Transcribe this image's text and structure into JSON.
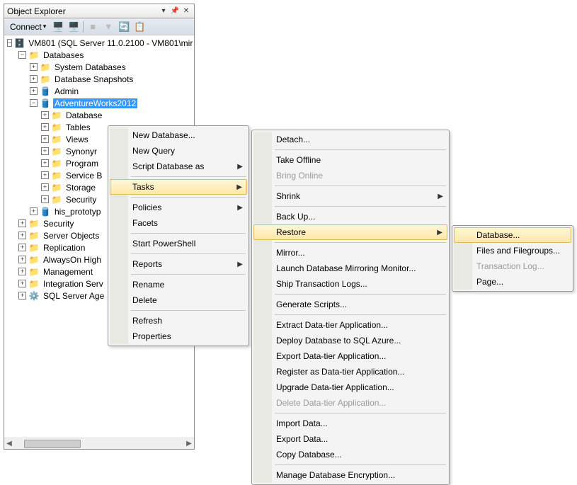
{
  "panel": {
    "title": "Object Explorer"
  },
  "toolbar": {
    "connect": "Connect"
  },
  "tree": {
    "server": "VM801 (SQL Server 11.0.2100 - VM801\\mir",
    "databases": "Databases",
    "sysdb": "System Databases",
    "snapshots": "Database Snapshots",
    "admin": "Admin",
    "aw": "AdventureWorks2012",
    "dbd": "Database",
    "tables": "Tables",
    "views": "Views",
    "synonyms": "Synonyr",
    "programmability": "Program",
    "servicebroker": "Service B",
    "storage": "Storage",
    "security_inner": "Security",
    "his": "his_prototyp",
    "security": "Security",
    "serverobjects": "Server Objects",
    "replication": "Replication",
    "alwayson": "AlwaysOn High",
    "management": "Management",
    "integration": "Integration Serv",
    "sqlagent": "SQL Server Age"
  },
  "menu1": {
    "newdb": "New Database...",
    "newquery": "New Query",
    "scriptdb": "Script Database as",
    "tasks": "Tasks",
    "policies": "Policies",
    "facets": "Facets",
    "startps": "Start PowerShell",
    "reports": "Reports",
    "rename": "Rename",
    "delete": "Delete",
    "refresh": "Refresh",
    "properties": "Properties"
  },
  "menu2": {
    "detach": "Detach...",
    "takeoffline": "Take Offline",
    "bringonline": "Bring Online",
    "shrink": "Shrink",
    "backup": "Back Up...",
    "restore": "Restore",
    "mirror": "Mirror...",
    "launchmirror": "Launch Database Mirroring Monitor...",
    "shiplogs": "Ship Transaction Logs...",
    "genscripts": "Generate Scripts...",
    "extractdac": "Extract Data-tier Application...",
    "deployazure": "Deploy Database to SQL Azure...",
    "exportdac": "Export Data-tier Application...",
    "registerdac": "Register as Data-tier Application...",
    "upgradedac": "Upgrade Data-tier Application...",
    "deletedac": "Delete Data-tier Application...",
    "importdata": "Import Data...",
    "exportdata": "Export Data...",
    "copydb": "Copy Database...",
    "encrypt": "Manage Database Encryption..."
  },
  "menu3": {
    "database": "Database...",
    "filesgroups": "Files and Filegroups...",
    "tlog": "Transaction Log...",
    "page": "Page..."
  }
}
